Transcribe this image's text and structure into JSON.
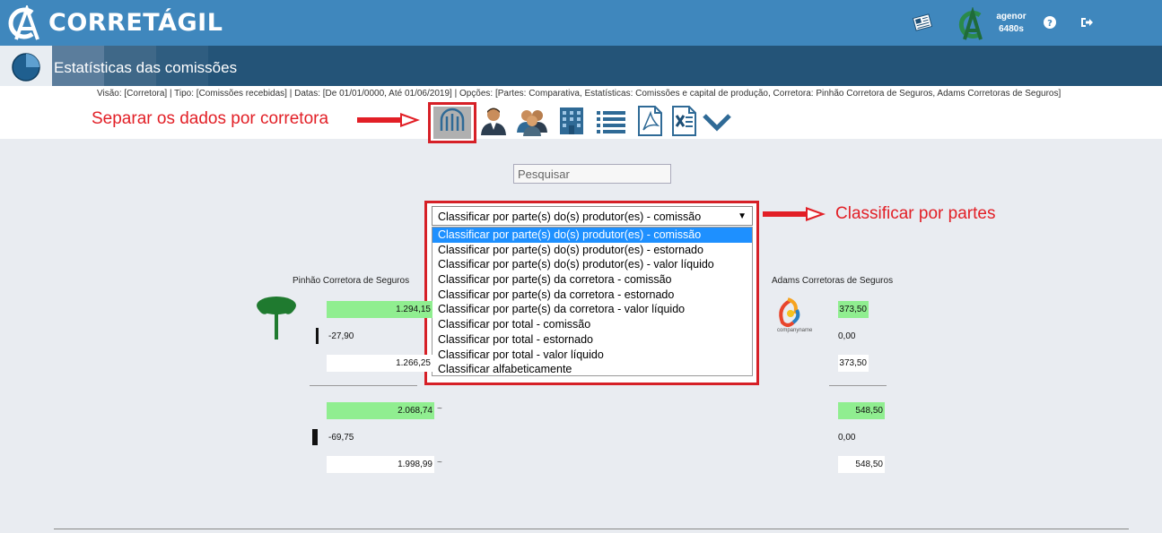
{
  "header": {
    "brand": "CORRETÁGIL",
    "user_name": "agenor",
    "user_points": "6480s"
  },
  "titlebar": {
    "title": "Estatísticas das comissões"
  },
  "filter_info": "Visão: [Corretora] | Tipo: [Comissões recebidas] | Datas: [De 01/01/0000, Até 01/06/2019] | Opções: [Partes: Comparativa, Estatísticas: Comissões e capital de produção, Corretora: Pinhão Corretora de Seguros, Adams Corretoras de Seguros]",
  "annotations": {
    "separate": "Separar os dados por corretora",
    "classify": "Classificar por partes"
  },
  "toolbar": {
    "icons": [
      "building-columns-icon",
      "user-icon",
      "group-icon",
      "office-icon",
      "list-icon",
      "pdf-icon",
      "excel-icon",
      "chevron-down-icon"
    ]
  },
  "search": {
    "placeholder": "Pesquisar"
  },
  "sort": {
    "selected": "Classificar por parte(s) do(s) produtor(es) - comissão",
    "options": [
      "Classificar por parte(s) do(s) produtor(es) - comissão",
      "Classificar por parte(s) do(s) produtor(es) - estornado",
      "Classificar por parte(s) do(s) produtor(es) - valor líquido",
      "Classificar por parte(s) da corretora - comissão",
      "Classificar por parte(s) da corretora - estornado",
      "Classificar por parte(s) da corretora - valor líquido",
      "Classificar por total - comissão",
      "Classificar por total - estornado",
      "Classificar por total - valor líquido",
      "Classificar alfabeticamente"
    ]
  },
  "corretoras": [
    {
      "name": "Pinhão Corretora de Seguros",
      "part": {
        "comissao": "1.294,15",
        "estornado": "-27,90",
        "liquido": "1.266,25"
      },
      "total": {
        "comissao": "2.068,74",
        "estornado": "-69,75",
        "liquido": "1.998,99"
      }
    },
    {
      "name": "Adams Corretoras de Seguros",
      "logo_text": "companyname",
      "part": {
        "comissao": "373,50",
        "estornado": "0,00",
        "liquido": "373,50"
      },
      "total": {
        "comissao": "548,50",
        "estornado": "0,00",
        "liquido": "548,50"
      }
    }
  ],
  "colors": {
    "topbar": "#3f87bd",
    "titlebar": "#245478",
    "annotation": "#e21f26",
    "positive": "#90ee90",
    "selected_option": "#1e90ff"
  }
}
